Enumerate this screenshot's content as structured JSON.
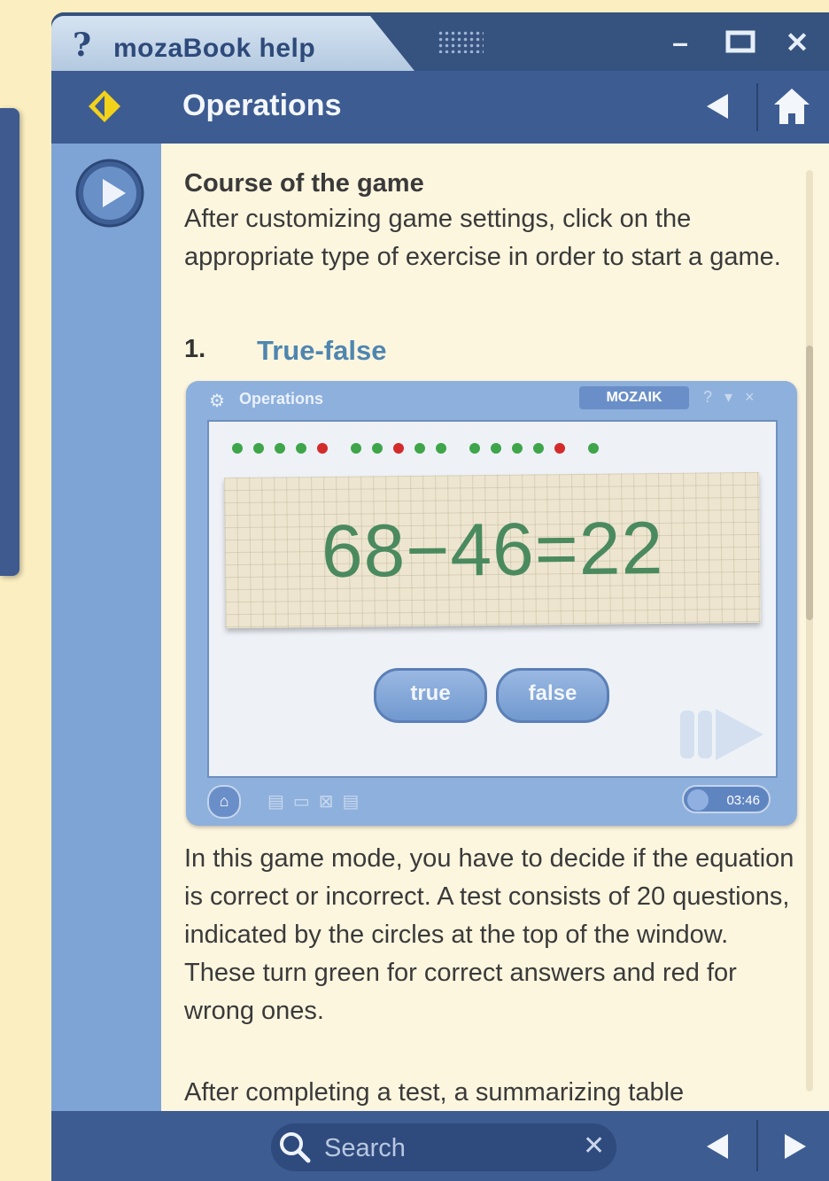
{
  "window": {
    "app_title": "mozaBook help",
    "help_glyph": "?",
    "controls": {
      "minimize": "–",
      "maximize": "□",
      "close": "✕"
    }
  },
  "header": {
    "title": "Operations"
  },
  "content": {
    "heading": "Course of the game",
    "intro": "After customizing game settings, click on the appropriate type of exercise in order to start a game.",
    "item_number": "1.",
    "item_title": "True-false",
    "paragraph": "In this game mode, you have to decide if the equation is correct or incorrect. A test consists of 20 questions, indicated by the circles at the top of the window. These turn green for correct answers and red for wrong ones.",
    "paragraph2": "After completing a test, a summarizing table"
  },
  "screenshot": {
    "window_title": "Operations",
    "logo": "MOZAIK",
    "equation": "68−46=22",
    "true_label": "true",
    "false_label": "false",
    "timer": "03:46",
    "progress_dots": [
      "green",
      "green",
      "green",
      "green",
      "red",
      "green",
      "green",
      "red",
      "green",
      "green",
      "green",
      "green",
      "green",
      "green",
      "red",
      "green"
    ],
    "colors": {
      "green": "#3fa54a",
      "red": "#d32b2b"
    }
  },
  "footer": {
    "search_placeholder": "Search",
    "clear_glyph": "✕"
  },
  "icons": {
    "diamond": "diamond-nav-icon",
    "play": "play-icon",
    "back": "back-arrow-icon",
    "home": "home-icon",
    "search": "search-icon",
    "prev": "prev-arrow-icon",
    "next": "next-arrow-icon"
  }
}
